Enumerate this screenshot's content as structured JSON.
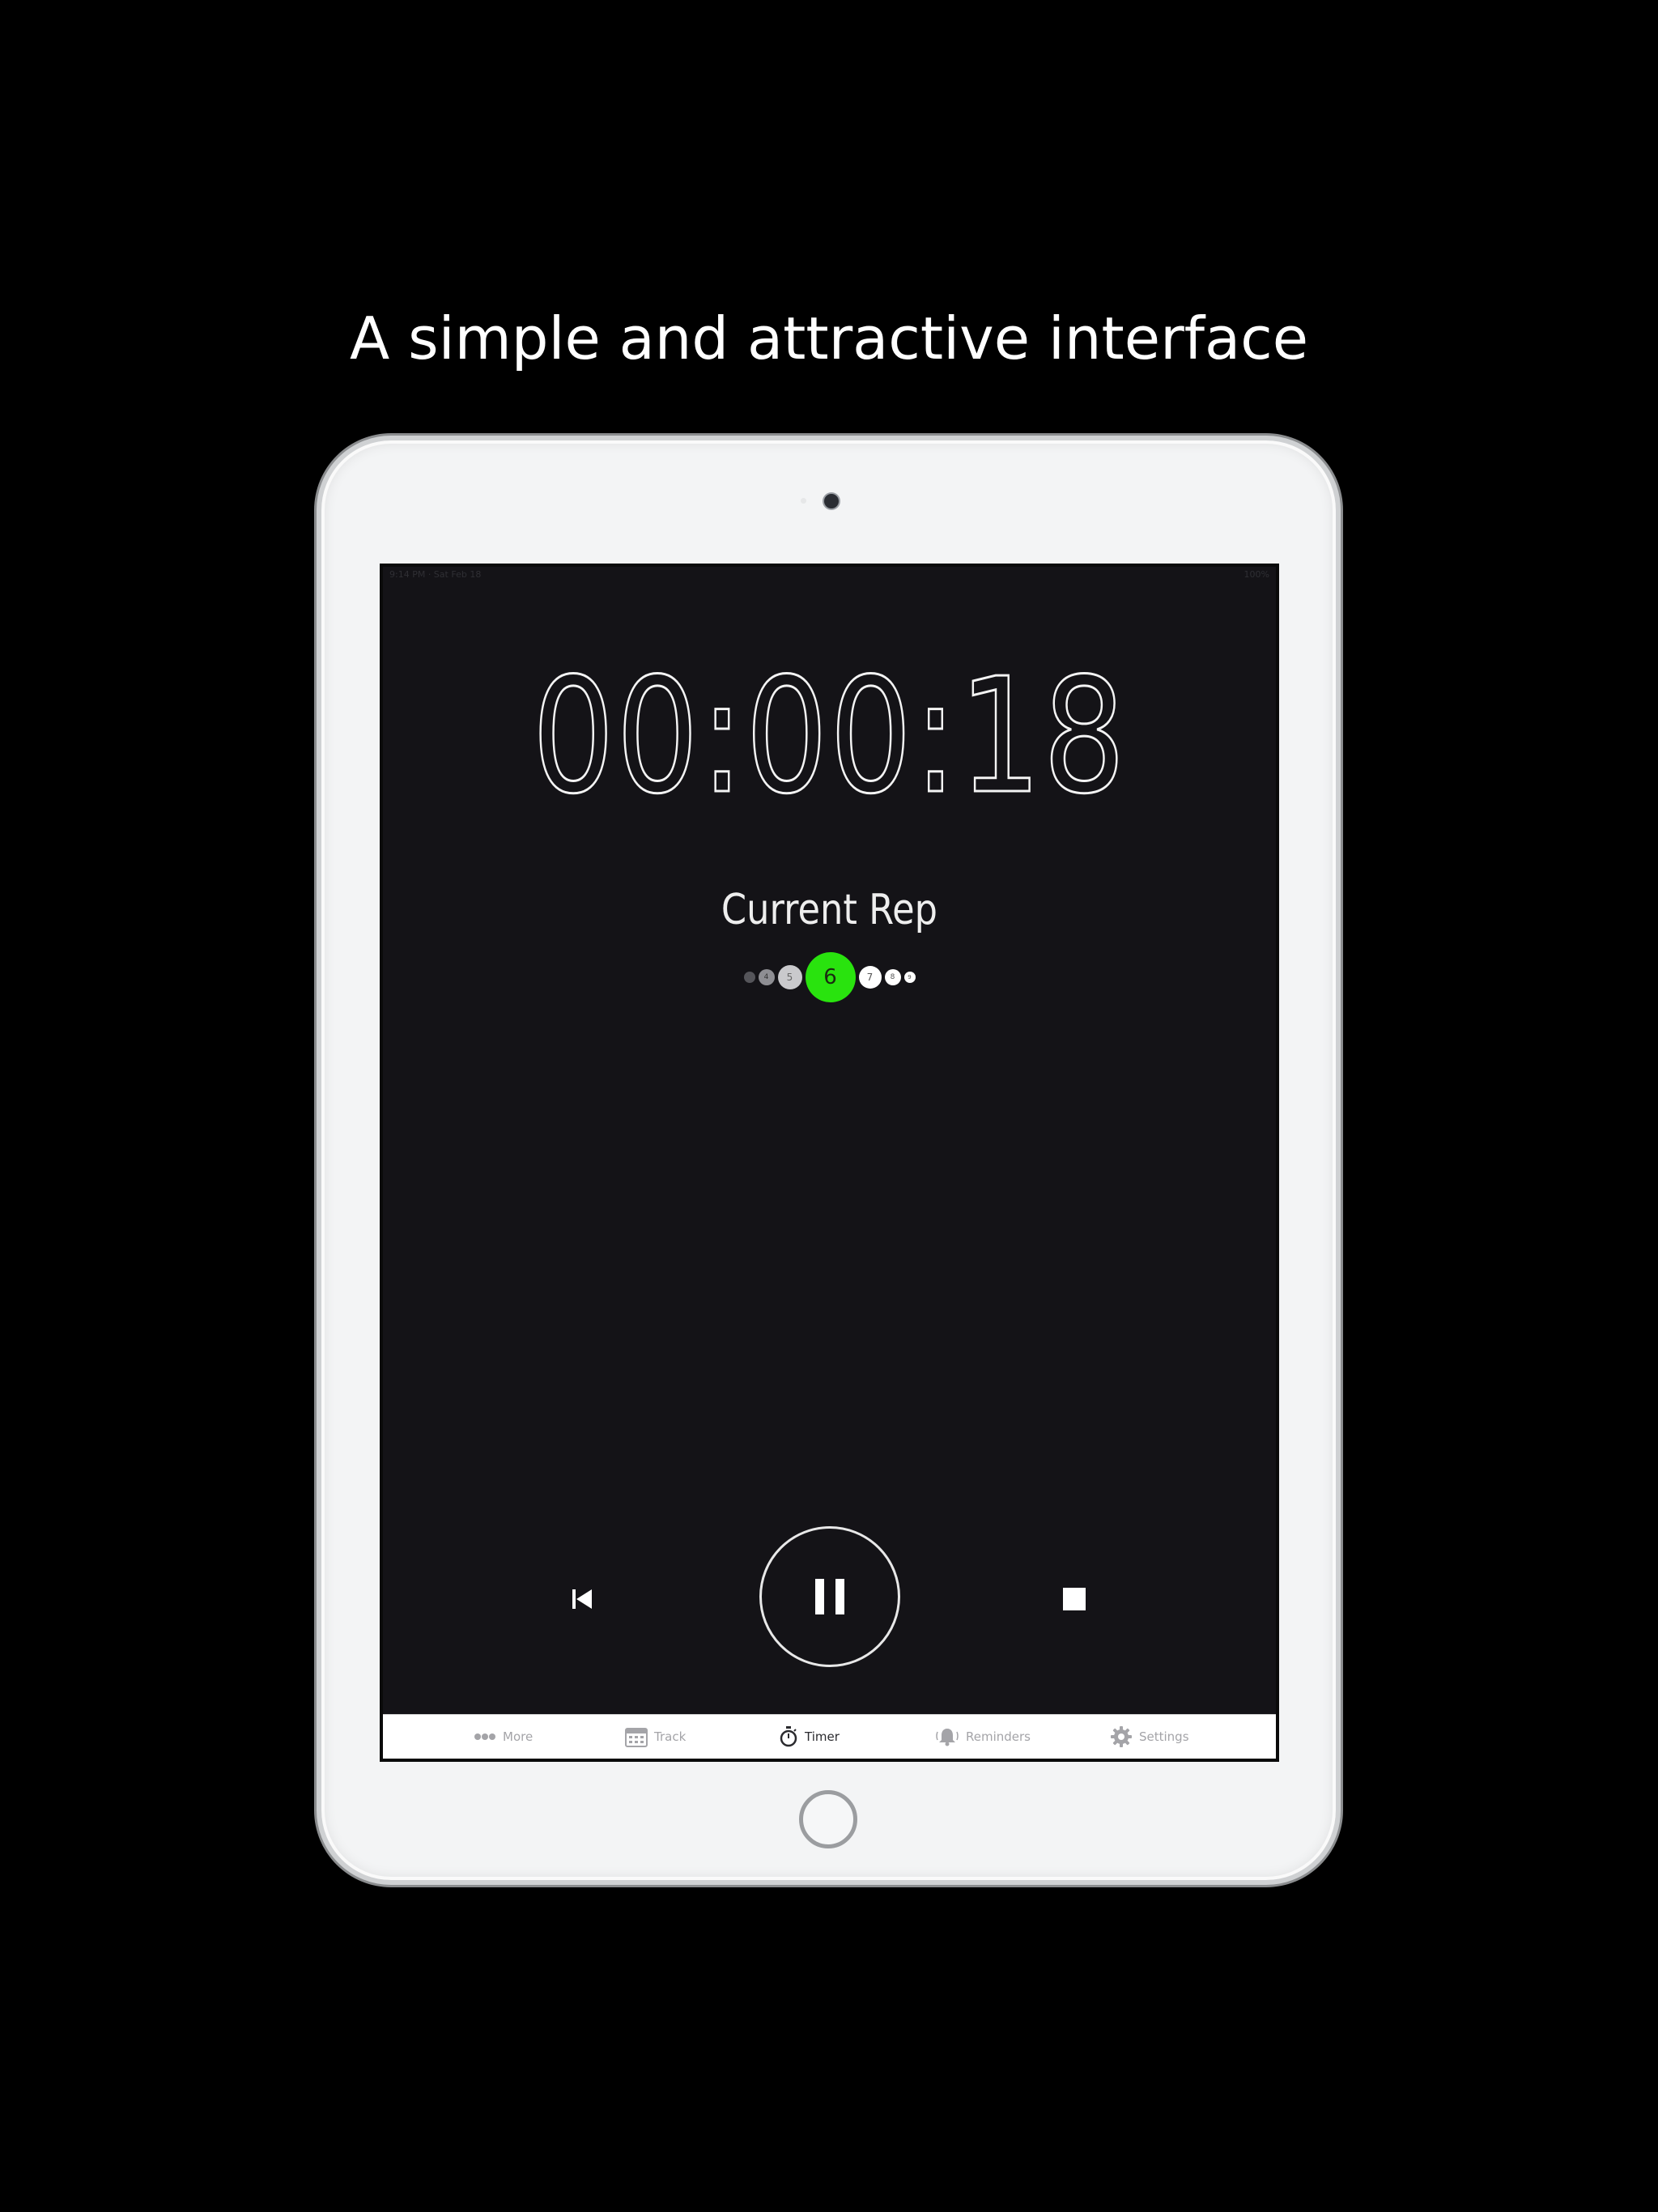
{
  "headline": "A simple and attractive interface",
  "status_bar": {
    "left": "9:14 PM · Sat Feb 18",
    "right": "100%"
  },
  "timer": {
    "display": "00:00:18"
  },
  "rep": {
    "label": "Current Rep",
    "current": "6",
    "dots": [
      "",
      "4",
      "5",
      "6",
      "7",
      "8",
      "9"
    ]
  },
  "controls": {
    "back": "skip-back-icon",
    "pause": "pause-icon",
    "stop": "stop-icon"
  },
  "tabs": [
    {
      "label": "More",
      "icon": "more-dots-icon",
      "active": false
    },
    {
      "label": "Track",
      "icon": "calendar-icon",
      "active": false
    },
    {
      "label": "Timer",
      "icon": "stopwatch-icon",
      "active": true
    },
    {
      "label": "Reminders",
      "icon": "bell-icon",
      "active": false
    },
    {
      "label": "Settings",
      "icon": "gear-icon",
      "active": false
    }
  ],
  "colors": {
    "screen_background": "#141317",
    "current_rep": "#29e30e",
    "page_background": "#000000"
  }
}
